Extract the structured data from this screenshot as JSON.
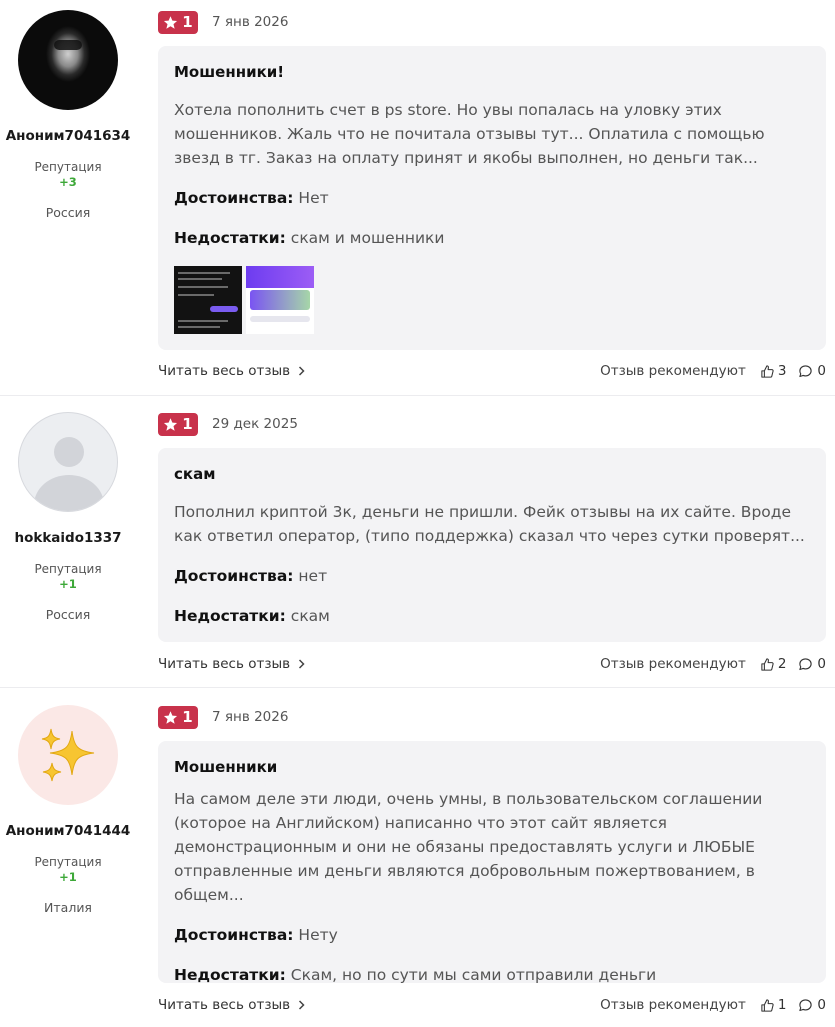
{
  "reviews": [
    {
      "author": {
        "name": "Аноним7041634",
        "reputation_label": "Репутация",
        "reputation": "+3",
        "country": "Россия"
      },
      "rating": "1",
      "date": "7 янв 2026",
      "title": "Мошенники!",
      "text": "Хотела пополнить счет в ps store. Но увы попалась на уловку этих мошенников. Жаль что не почитала отзывы тут... Оплатила с помощью звезд в тг. Заказ на оплату принят и якобы выполнен, но деньги так...",
      "pros_label": "Достоинства:",
      "pros": "Нет",
      "cons_label": "Недостатки:",
      "cons": "скам и мошенники",
      "read_more": "Читать весь отзыв",
      "recommend": "Отзыв рекомендуют",
      "likes": "3",
      "comments": "0"
    },
    {
      "author": {
        "name": "hokkaido1337",
        "reputation_label": "Репутация",
        "reputation": "+1",
        "country": "Россия"
      },
      "rating": "1",
      "date": "29 дек 2025",
      "title": "скам",
      "text": "Пополнил криптой 3к, деньги не пришли. Фейк отзывы на их сайте. Вроде как ответил оператор, (типо поддержка) сказал что через сутки проверят...",
      "pros_label": "Достоинства:",
      "pros": "нет",
      "cons_label": "Недостатки:",
      "cons": "скам",
      "read_more": "Читать весь отзыв",
      "recommend": "Отзыв рекомендуют",
      "likes": "2",
      "comments": "0"
    },
    {
      "author": {
        "name": "Аноним7041444",
        "reputation_label": "Репутация",
        "reputation": "+1",
        "country": "Италия"
      },
      "rating": "1",
      "date": "7 янв 2026",
      "title": "Мошенники",
      "text": "На самом деле эти люди, очень умны, в пользовательском соглашении (которое на Английском) написанно что этот сайт является демонстрационным и они не обязаны предоставлять услуги и ЛЮБЫЕ отправленные им деньги являются добровольным пожертвованием, в общем...",
      "pros_label": "Достоинства:",
      "pros": "Нету",
      "cons_label": "Недостатки:",
      "cons": "Скам, но по сути мы сами отправили деньги",
      "read_more": "Читать весь отзыв",
      "recommend": "Отзыв рекомендуют",
      "likes": "1",
      "comments": "0"
    }
  ],
  "colors": {
    "badge": "#c8324b",
    "reputation": "#3da838",
    "card_bg": "#f3f3f5"
  },
  "icons": {
    "rating": "star-icon",
    "read_more": "chevron-right-icon",
    "likes": "thumbs-up-icon",
    "comments": "comment-icon",
    "avatar3": "sparkles-icon"
  }
}
